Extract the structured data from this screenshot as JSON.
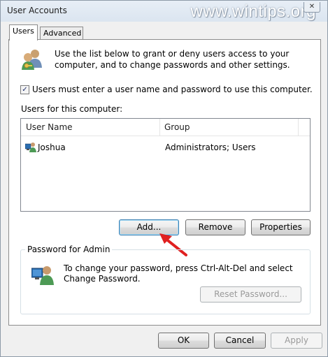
{
  "window": {
    "title": "User Accounts",
    "close_symbol": "✕"
  },
  "watermark": "www.wintips.org",
  "tabs": [
    {
      "label": "Users",
      "active": true
    },
    {
      "label": "Advanced",
      "active": false
    }
  ],
  "users_tab": {
    "intro_text": "Use the list below to grant or deny users access to your computer, and to change passwords and other settings.",
    "require_login_checkbox": {
      "label": "Users must enter a user name and password to use this computer.",
      "checked": true,
      "mark": "✓"
    },
    "users_list_label": "Users for this computer:",
    "columns": [
      "User Name",
      "Group"
    ],
    "rows": [
      {
        "user_name": "Joshua",
        "group": "Administrators; Users"
      }
    ],
    "buttons": {
      "add": "Add...",
      "remove": "Remove",
      "properties": "Properties"
    },
    "password_group": {
      "title": "Password for Admin",
      "text": "To change your password, press Ctrl-Alt-Del and select Change Password.",
      "reset_button": "Reset Password..."
    }
  },
  "footer_buttons": {
    "ok": "OK",
    "cancel": "Cancel",
    "apply": "Apply"
  },
  "colors": {
    "arrow": "#e02020",
    "window_bg": "#f0f0f0",
    "focus_border": "#3c7fb1"
  }
}
